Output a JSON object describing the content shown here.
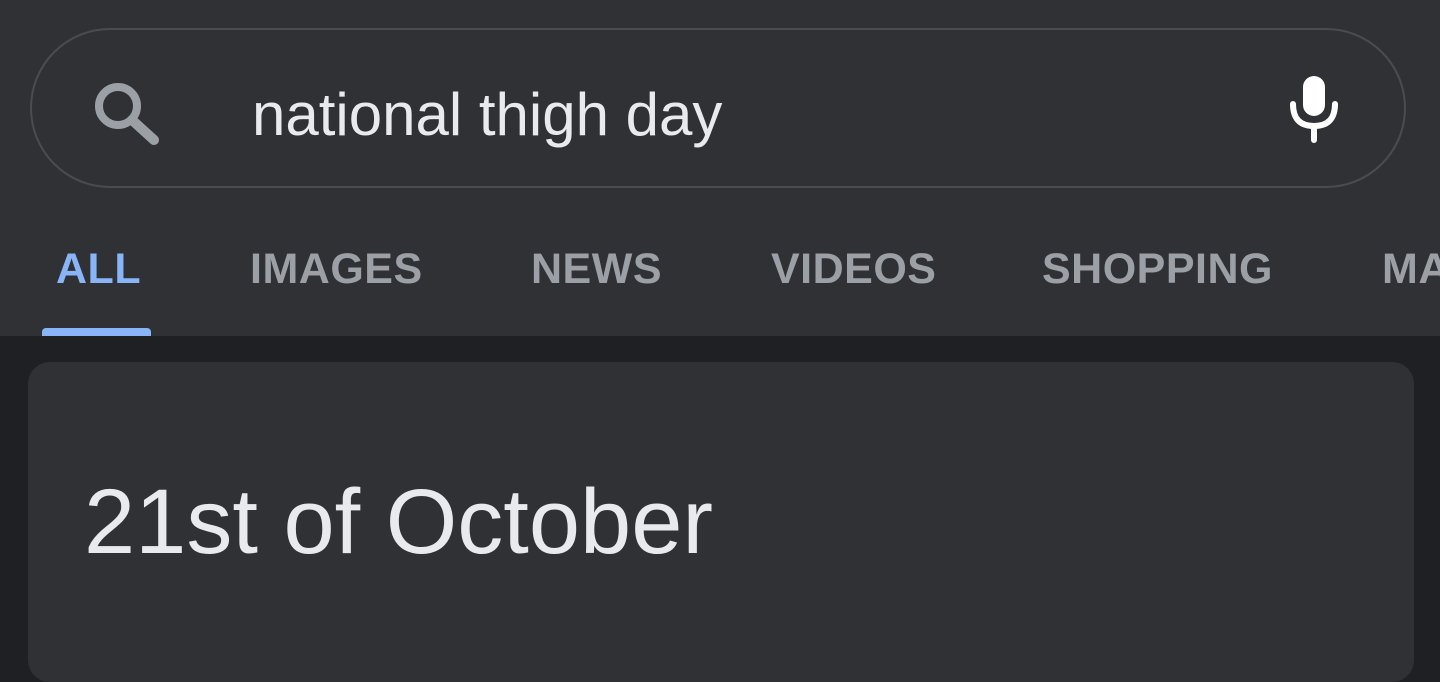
{
  "search": {
    "query": "national thigh day",
    "search_icon": "search-icon",
    "mic_icon": "mic-icon"
  },
  "tabs": [
    {
      "label": "ALL",
      "active": true
    },
    {
      "label": "IMAGES",
      "active": false
    },
    {
      "label": "NEWS",
      "active": false
    },
    {
      "label": "VIDEOS",
      "active": false
    },
    {
      "label": "SHOPPING",
      "active": false
    },
    {
      "label": "MA",
      "active": false
    }
  ],
  "result": {
    "answer": "21st of October"
  },
  "colors": {
    "background": "#1f2023",
    "surface": "#303134",
    "text": "#e8eaed",
    "muted": "#9aa0a6",
    "accent": "#8ab4f8"
  }
}
